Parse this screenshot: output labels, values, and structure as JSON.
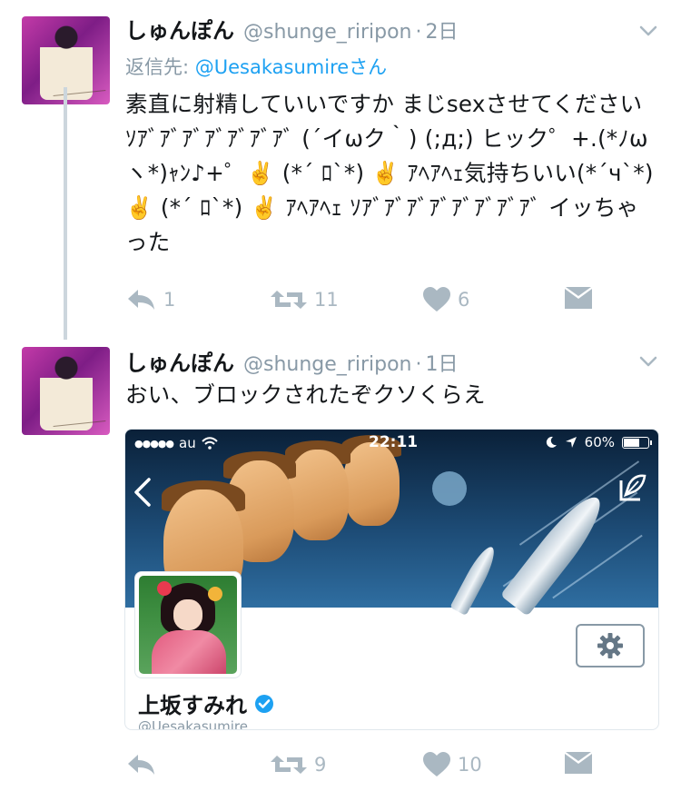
{
  "colors": {
    "text": "#14171a",
    "muted": "#8899a6",
    "action": "#aab8c2",
    "link": "#1da1f2",
    "thread_line": "#ccd6dd",
    "verified": "#1da1f2"
  },
  "tweets": [
    {
      "name": "しゅんぽん",
      "handle": "@shunge_riripon",
      "dot": "·",
      "time": "2日",
      "reply_prefix": "返信先: ",
      "reply_mention": "@Uesakasumire",
      "reply_suffix": "さん",
      "text": "素直に射精していいですか まじsexさせてください ｿｱﾞｱﾞｱﾞｱﾞｱﾞｱﾞｱﾞ (´イωク｀) (;д;) ヒック゜+.(*ﾉω ヽ*)ｬﾝ♪+゜✌️ (*´ ﾛ`*) ✌️ ｱﾍｱﾍｪ気持ちいい(*´ч`*) ✌️ (*´ ﾛ`*) ✌️ ｱﾍｱﾍｪ ｿｱﾞｱﾞｱﾞｱﾞｱﾞｱﾞｱﾞｱﾞ イッちゃった",
      "actions": {
        "reply_count": "1",
        "retweet_count": "11",
        "like_count": "6"
      },
      "icons": {
        "reply": "reply-icon",
        "retweet": "retweet-icon",
        "like": "heart-icon",
        "dm": "envelope-icon",
        "more": "chevron-down-icon"
      }
    },
    {
      "name": "しゅんぽん",
      "handle": "@shunge_riripon",
      "dot": "·",
      "time": "1日",
      "text": "おい、ブロックされたぞクソくらえ",
      "actions": {
        "reply_count": "",
        "retweet_count": "9",
        "like_count": "10"
      },
      "media": {
        "status_carrier": "au",
        "status_time": "22:11",
        "status_battery": "60%",
        "battery_level": 0.6,
        "profile_name": "上坂すみれ",
        "profile_handle": "@Uesakasumire",
        "icons": {
          "back": "back-chevron-icon",
          "compose": "compose-icon",
          "settings": "gear-icon",
          "verified": "verified-badge-icon",
          "wifi": "wifi-icon",
          "moon": "moon-icon",
          "location": "location-arrow-icon"
        }
      }
    }
  ]
}
